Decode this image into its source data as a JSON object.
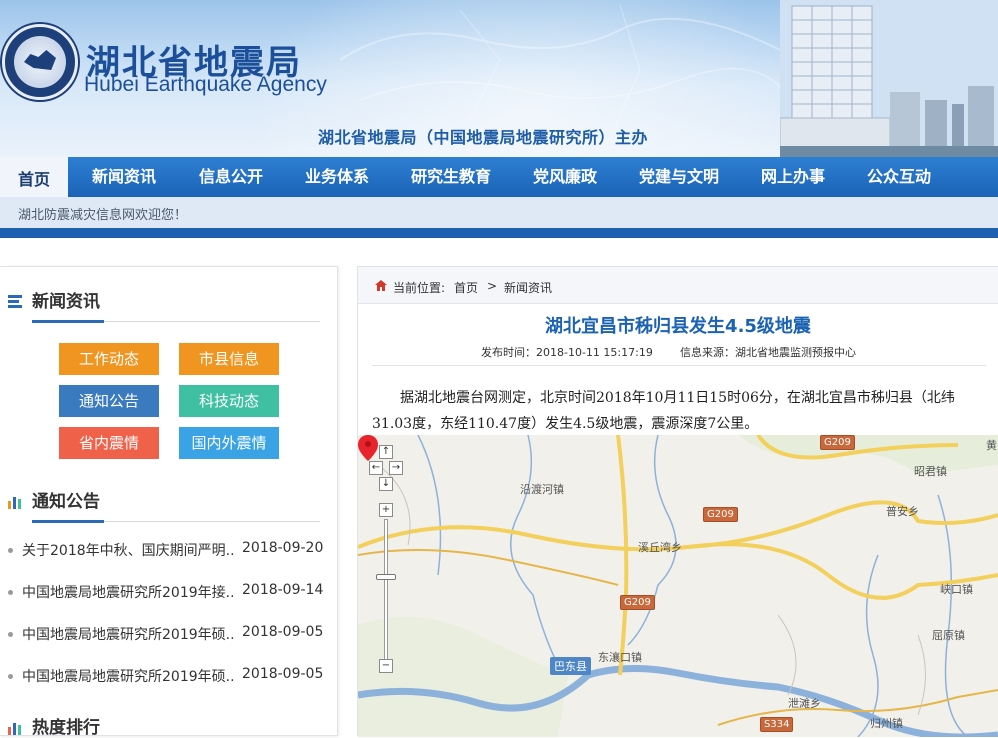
{
  "header": {
    "title_cn": "湖北省地震局",
    "title_en": "Hubei Earthquake Agency",
    "subtitle": "湖北省地震局（中国地震局地震研究所）主办"
  },
  "nav": {
    "items": [
      "首页",
      "新闻资讯",
      "信息公开",
      "业务体系",
      "研究生教育",
      "党风廉政",
      "党建与文明",
      "网上办事",
      "公众互动"
    ],
    "active": "首页"
  },
  "welcome": "湖北防震减灾信息网欢迎您！",
  "sidebar": {
    "news_title": "新闻资讯",
    "categories": [
      "工作动态",
      "市县信息",
      "通知公告",
      "科技动态",
      "省内震情",
      "国内外震情"
    ],
    "category_colors": [
      "#f0951f",
      "#f0951f",
      "#3a7bbf",
      "#3fc0a2",
      "#f0614a",
      "#3aa3e6"
    ],
    "notice_title": "通知公告",
    "notices": [
      {
        "title": "关于2018年中秋、国庆期间严明...",
        "date": "2018-09-20"
      },
      {
        "title": "中国地震局地震研究所2019年接...",
        "date": "2018-09-14"
      },
      {
        "title": "中国地震局地震研究所2019年硕...",
        "date": "2018-09-05"
      },
      {
        "title": "中国地震局地震研究所2019年硕...",
        "date": "2018-09-05"
      }
    ],
    "hot_title": "热度排行"
  },
  "main": {
    "breadcrumb": {
      "label": "当前位置:",
      "home": "首页",
      "sep": ">",
      "current": "新闻资讯"
    },
    "article_title": "湖北宜昌市秭归县发生4.5级地震",
    "publish_time": "发布时间：2018-10-11 15:17:19",
    "source": "信息来源：湖北省地震监测预报中心",
    "body": "据湖北地震台网测定，北京时间2018年10月11日15时06分，在湖北宜昌市秭归县（北纬31.03度，东经110.47度）发生4.5级地震，震源深度7公里。"
  },
  "map": {
    "places": [
      "沿渡河镇",
      "溪丘湾乡",
      "东瀼口镇",
      "昭君镇",
      "普安乡",
      "峡口镇",
      "屈原镇",
      "泄滩乡",
      "归州镇"
    ],
    "roads": [
      "G209",
      "G209",
      "G209",
      "S334"
    ],
    "county": "巴东县",
    "edge_char": "黄",
    "zoom_in": "+",
    "zoom_out": "−",
    "pan": [
      "↑",
      "←",
      "→",
      "↓"
    ]
  }
}
